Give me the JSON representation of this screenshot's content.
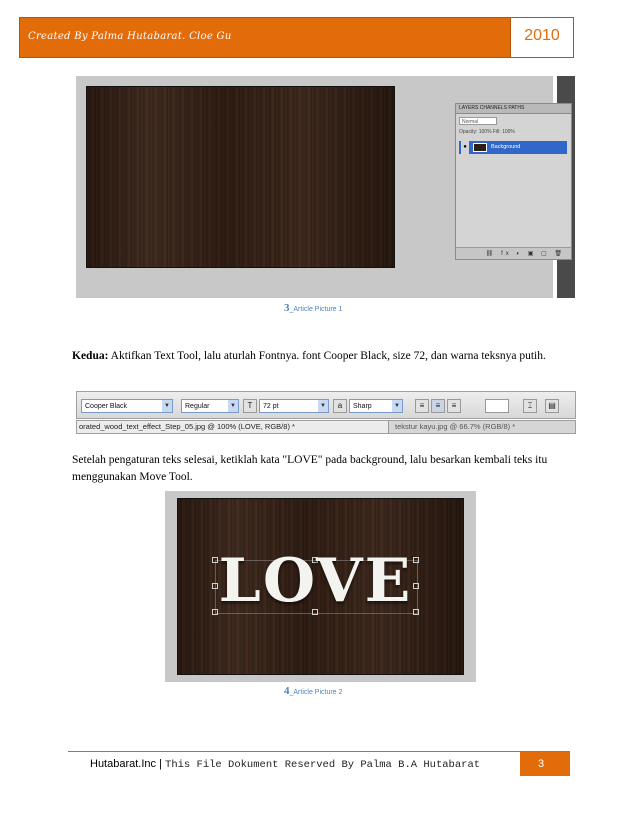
{
  "header": {
    "title": "Created By Palma Hutabarat. Cloe Gu",
    "year": "2010"
  },
  "figure1": {
    "layers_panel": {
      "tabs": "LAYERS  CHANNELS  PATHS",
      "blend_mode": "Normal",
      "opacity_row": "Opacity: 100%  Fill: 100%",
      "layer_name": "Background",
      "bottom_icons": "⛓ fx ◐ ▣ ▢ 🗑"
    },
    "caption_number": "3",
    "caption_text": "_Article Picture 1"
  },
  "paragraph1": {
    "bold": "Kedua:",
    "text": " Aktifkan Text Tool, lalu aturlah Fontnya. font Cooper Black, size 72, dan warna teksnya putih."
  },
  "toolbar": {
    "font_family": "Cooper Black",
    "font_style": "Regular",
    "font_size": "72 pt",
    "aa_label": "a",
    "antialias": "Sharp",
    "file_tab_active": "orated_wood_text_effect_Step_05.jpg @ 100% (LOVE, RGB/8) *",
    "file_tab_other": "tekstur kayu.jpg @ 66.7% (RGB/8) *"
  },
  "paragraph2": {
    "text": "Setelah pengaturan teks selesai, ketiklah kata \"LOVE\" pada background, lalu besarkan kembali teks itu menggunakan Move Tool."
  },
  "figure2": {
    "love_text": "LOVE",
    "caption_number": "4",
    "caption_text": "_Article Picture 2"
  },
  "footer": {
    "company": "Hutabarat.Inc | ",
    "reserved": "This File Dokument Reserved By Palma B.A Hutabarat",
    "page_number": "3"
  },
  "colors": {
    "accent": "#e36c0a",
    "caption": "#4f81bd",
    "layer_selected": "#3167c9"
  }
}
